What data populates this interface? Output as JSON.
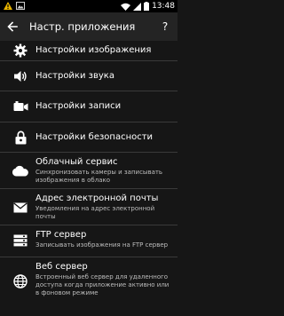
{
  "status_bar": {
    "time": "13:48",
    "left_icons": [
      "warning-icon",
      "image-icon"
    ],
    "right_icons": [
      "wifi-icon",
      "signal-icon",
      "battery-icon"
    ]
  },
  "app_bar": {
    "title": "Настр. приложения",
    "help_label": "?"
  },
  "settings": [
    {
      "icon": "gear-icon",
      "title": "Настройки изображения"
    },
    {
      "icon": "speaker-icon",
      "title": "Настройки звука"
    },
    {
      "icon": "video-camera-icon",
      "title": "Настройки записи"
    },
    {
      "icon": "lock-icon",
      "title": "Настройки безопасности"
    },
    {
      "icon": "cloud-icon",
      "title": "Облачный сервис",
      "subtitle": "Синхронизовать камеры и записывать изображения в облако"
    },
    {
      "icon": "email-icon",
      "title": "Адрес электронной почты",
      "subtitle": "Уведомления на адрес электронной почты"
    },
    {
      "icon": "server-icon",
      "title": "FTP сервер",
      "subtitle": "Записывать изображения на FTP сервер"
    },
    {
      "icon": "globe-icon",
      "title": "Веб сервер",
      "subtitle": "Встроенный веб сервер для удаленного доступа когда приложение активно или в фоновом режиме"
    }
  ],
  "colors": {
    "background": "#161616",
    "app_bar": "#242424",
    "status_bar": "#000000",
    "accent_time": "#ffffff",
    "warning_icon": "#e8b400",
    "divider": "#3a3a3a"
  }
}
